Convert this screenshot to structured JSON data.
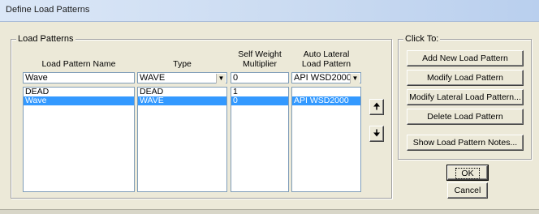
{
  "window": {
    "title": "Define Load Patterns"
  },
  "load_patterns": {
    "group_label": "Load Patterns",
    "headers": {
      "name": "Load Pattern Name",
      "type": "Type",
      "self_weight": [
        "Self Weight",
        "Multiplier"
      ],
      "auto_lateral": [
        "Auto Lateral",
        "Load Pattern"
      ]
    },
    "edit_row": {
      "name": "Wave",
      "type": "WAVE",
      "multiplier": "0",
      "auto_lateral": "API WSD2000"
    },
    "rows": [
      {
        "name": "DEAD",
        "type": "DEAD",
        "multiplier": "1",
        "auto_lateral": "",
        "selected": false
      },
      {
        "name": "Wave",
        "type": "WAVE",
        "multiplier": "0",
        "auto_lateral": "API WSD2000",
        "selected": true
      }
    ],
    "move_up_icon": "arrow-up-icon",
    "move_down_icon": "arrow-down-icon"
  },
  "click_to": {
    "group_label": "Click To:",
    "buttons": {
      "add_new": "Add New Load Pattern",
      "modify": "Modify Load Pattern",
      "modify_lateral": "Modify Lateral Load Pattern...",
      "delete": "Delete Load Pattern",
      "show_notes": "Show Load Pattern Notes..."
    }
  },
  "footer": {
    "ok": "OK",
    "cancel": "Cancel"
  },
  "colors": {
    "selection": "#3399ff",
    "dialog_bg": "#ece9d8"
  }
}
